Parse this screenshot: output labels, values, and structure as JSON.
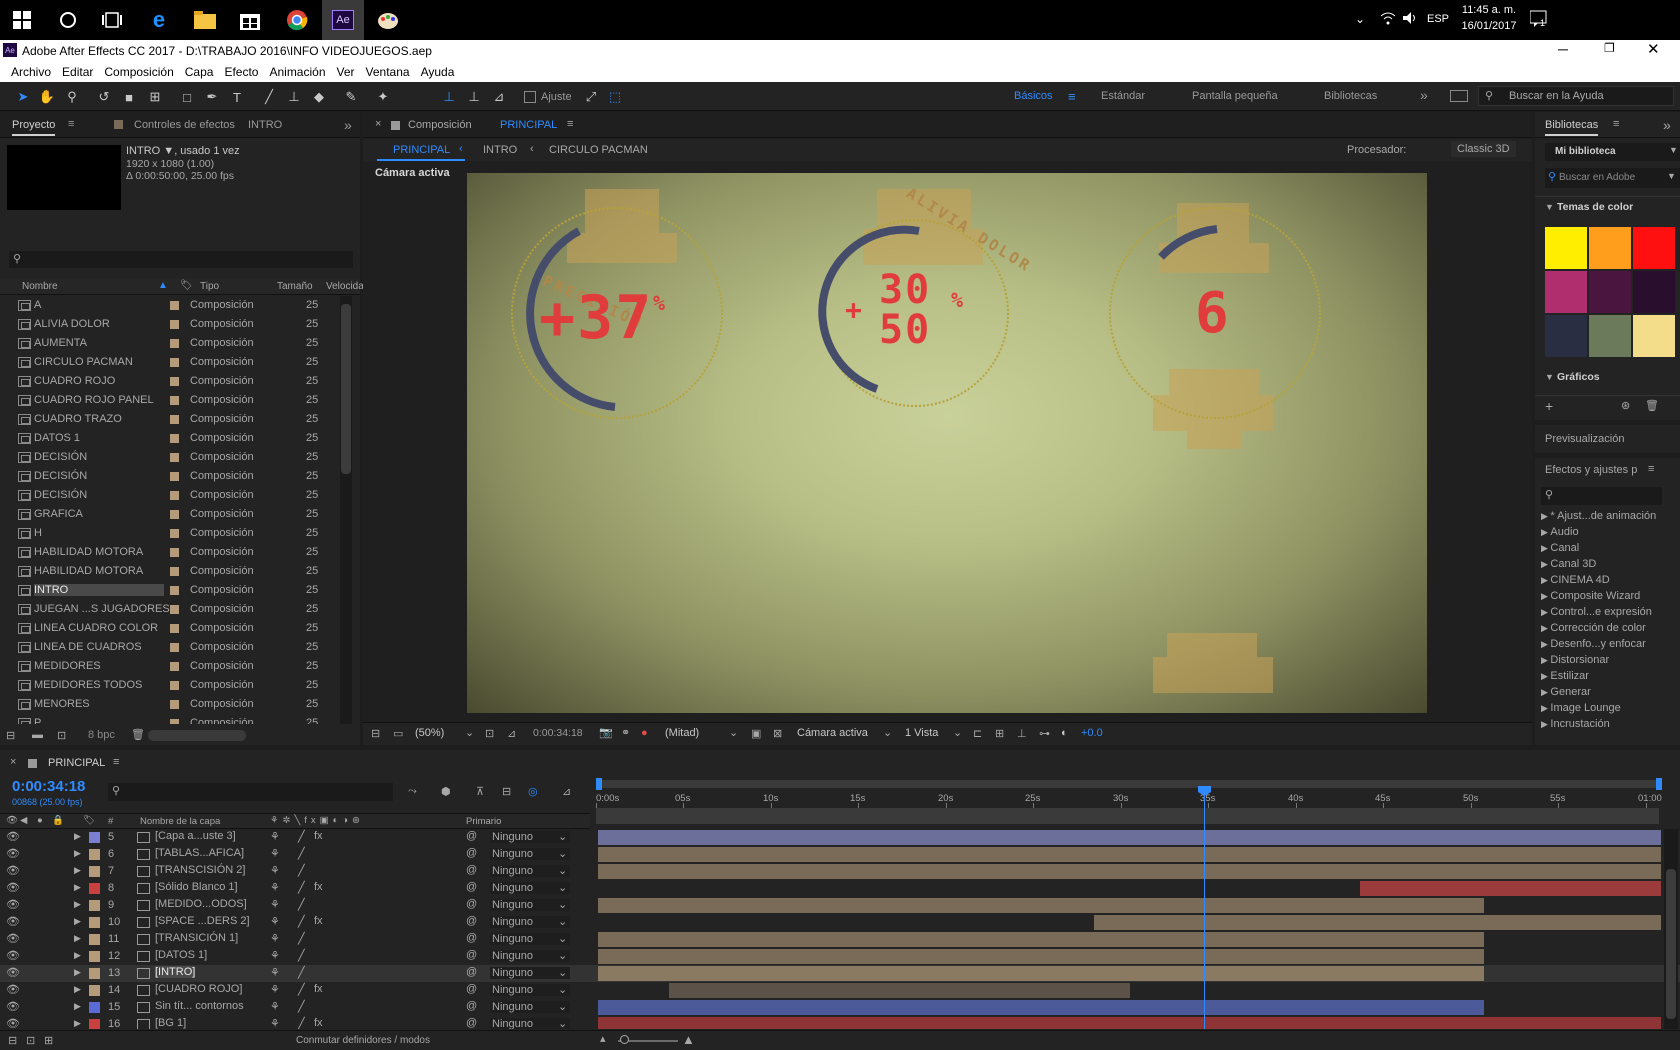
{
  "taskbar": {
    "time": "11:45 a. m.",
    "date": "16/01/2017",
    "lang": "ESP",
    "notif": "1"
  },
  "window": {
    "title": "Adobe After Effects CC 2017 - D:\\TRABAJO 2016\\INFO VIDEOJUEGOS.aep"
  },
  "menu": [
    "Archivo",
    "Editar",
    "Composición",
    "Capa",
    "Efecto",
    "Animación",
    "Ver",
    "Ventana",
    "Ayuda"
  ],
  "toolbar": {
    "ajuste": "Ajuste",
    "workspaces": [
      "Básicos",
      "Estándar",
      "Pantalla pequeña",
      "Bibliotecas"
    ],
    "search_placeholder": "Buscar en la Ayuda"
  },
  "project": {
    "tab": "Proyecto",
    "tab2": "Controles de efectos",
    "tab2_target": "INTRO",
    "item_name": "INTRO",
    "item_usage": ", usado 1 vez",
    "item_size": "1920 x 1080 (1.00)",
    "item_duration": "Δ 0:00:50:00, 25.00 fps",
    "cols": [
      "Nombre",
      "Tipo",
      "Tamaño",
      "Velocida"
    ],
    "bpc": "8 bpc",
    "items": [
      [
        "A",
        "Composición",
        "25"
      ],
      [
        "ALIVIA DOLOR",
        "Composición",
        "25"
      ],
      [
        "AUMENTA",
        "Composición",
        "25"
      ],
      [
        "CIRCULO PACMAN",
        "Composición",
        "25"
      ],
      [
        "CUADRO ROJO",
        "Composición",
        "25"
      ],
      [
        "CUADRO ROJO PANEL",
        "Composición",
        "25"
      ],
      [
        "CUADRO TRAZO",
        "Composición",
        "25"
      ],
      [
        "DATOS 1",
        "Composición",
        "25"
      ],
      [
        "DECISIÓN",
        "Composición",
        "25"
      ],
      [
        "DECISIÓN",
        "Composición",
        "25"
      ],
      [
        "DECISIÓN",
        "Composición",
        "25"
      ],
      [
        "GRAFICA",
        "Composición",
        "25"
      ],
      [
        "H",
        "Composición",
        "25"
      ],
      [
        "HABILIDAD MOTORA",
        "Composición",
        "25"
      ],
      [
        "HABILIDAD MOTORA",
        "Composición",
        "25"
      ],
      [
        "INTRO",
        "Composición",
        "25"
      ],
      [
        "JUEGAN ...S JUGADORES",
        "Composición",
        "25"
      ],
      [
        "LINEA CUADRO COLOR",
        "Composición",
        "25"
      ],
      [
        "LINEA DE CUADROS",
        "Composición",
        "25"
      ],
      [
        "MEDIDORES",
        "Composición",
        "25"
      ],
      [
        "MEDIDORES TODOS",
        "Composición",
        "25"
      ],
      [
        "MENORES",
        "Composición",
        "25"
      ],
      [
        "P",
        "Composición",
        "25"
      ]
    ]
  },
  "comp": {
    "tab_prefix": "Composición",
    "tab_name": "PRINCIPAL",
    "crumbs": [
      "PRINCIPAL",
      "INTRO",
      "CIRCULO PACMAN"
    ],
    "processor_label": "Procesador:",
    "processor": "Classic 3D",
    "camera_label": "Cámara activa",
    "hud": {
      "left_label": "PRECISIÓN",
      "left_value": "+37",
      "left_unit": "%",
      "mid_label": "ALIVIA DOLOR",
      "mid_top": "30",
      "mid_bottom": "50",
      "mid_plus": "+",
      "mid_unit": "%",
      "right_value": "6"
    },
    "footer": {
      "zoom": "(50%)",
      "timecode": "0:00:34:18",
      "resolution": "(Mitad)",
      "camera": "Cámara activa",
      "views": "1 Vista",
      "exposure": "+0.0"
    }
  },
  "libraries": {
    "tab": "Bibliotecas",
    "library": "Mi biblioteca",
    "search_placeholder": "Buscar en Adobe",
    "color_themes": "Temas de color",
    "graphics": "Gráficos",
    "colors": [
      "#ffee00",
      "#ff9e1c",
      "#ff1010",
      "#b02e6e",
      "#4a1640",
      "#2a0e2e",
      "#2a2e42",
      "#6a7a5a",
      "#f3dc8a"
    ]
  },
  "preview": {
    "tab": "Previsualización"
  },
  "effects": {
    "tab": "Efectos y ajustes p",
    "items": [
      "* Ajust...de animación",
      "Audio",
      "Canal",
      "Canal 3D",
      "CINEMA 4D",
      "Composite Wizard",
      "Control...e expresión",
      "Corrección de color",
      "Desenfo...y enfocar",
      "Distorsionar",
      "Estilizar",
      "Generar",
      "Image Lounge",
      "Incrustación"
    ]
  },
  "timeline": {
    "tab": "PRINCIPAL",
    "timecode": "0:00:34:18",
    "frames": "00868 (25.00 fps)",
    "col_num": "#",
    "col_name": "Nombre de la capa",
    "col_parent": "Primario",
    "footer": "Conmutar definidores / modos",
    "ruler": [
      "0:00s",
      "05s",
      "10s",
      "15s",
      "20s",
      "25s",
      "30s",
      "35s",
      "40s",
      "45s",
      "50s",
      "55s",
      "01:00"
    ],
    "playhead": 34.72,
    "layers": [
      {
        "num": "5",
        "name": "[Capa a...uste 3]",
        "label": "#7b7fd1",
        "parent": "Ninguno",
        "start": 0,
        "end": 60,
        "color": "#6c6f9a",
        "fx": true
      },
      {
        "num": "6",
        "name": "[TABLAS...AFICA]",
        "label": "#b59b7a",
        "parent": "Ninguno",
        "start": 0,
        "end": 60,
        "color": "#7a6b58",
        "fx": false
      },
      {
        "num": "7",
        "name": "[TRANSCISIÓN 2]",
        "label": "#b59b7a",
        "parent": "Ninguno",
        "start": 0,
        "end": 60,
        "color": "#7a6b58",
        "fx": false
      },
      {
        "num": "8",
        "name": "[Sólido Blanco 1]",
        "label": "#c94040",
        "parent": "Ninguno",
        "start": 43,
        "end": 60,
        "color": "#9c3b3b",
        "fx": true
      },
      {
        "num": "9",
        "name": "[MEDIDO...ODOS]",
        "label": "#b59b7a",
        "parent": "Ninguno",
        "start": 0,
        "end": 50,
        "color": "#7a6b58",
        "fx": false
      },
      {
        "num": "10",
        "name": "[SPACE ...DERS 2]",
        "label": "#b59b7a",
        "parent": "Ninguno",
        "start": 28,
        "end": 60,
        "color": "#7a6b58",
        "fx": true
      },
      {
        "num": "11",
        "name": "[TRANSICIÓN 1]",
        "label": "#b59b7a",
        "parent": "Ninguno",
        "start": 0,
        "end": 50,
        "color": "#7a6b58",
        "fx": false
      },
      {
        "num": "12",
        "name": "[DATOS 1]",
        "label": "#b59b7a",
        "parent": "Ninguno",
        "start": 0,
        "end": 50,
        "color": "#7a6b58",
        "fx": false
      },
      {
        "num": "13",
        "name": "[INTRO]",
        "label": "#b59b7a",
        "parent": "Ninguno",
        "start": 0,
        "end": 50,
        "color": "#8a7a62",
        "fx": false
      },
      {
        "num": "14",
        "name": "[CUADRO ROJO]",
        "label": "#b59b7a",
        "parent": "Ninguno",
        "start": 4,
        "end": 30,
        "color": "#5c5248",
        "fx": true
      },
      {
        "num": "15",
        "name": "Sin tít... contornos",
        "label": "#5a6ad6",
        "parent": "Ninguno",
        "start": 0,
        "end": 50,
        "color": "#4d5a99",
        "fx": false
      },
      {
        "num": "16",
        "name": "[BG 1]",
        "label": "#c94040",
        "parent": "Ninguno",
        "start": 0,
        "end": 60,
        "color": "#8e3434",
        "fx": true
      }
    ]
  }
}
